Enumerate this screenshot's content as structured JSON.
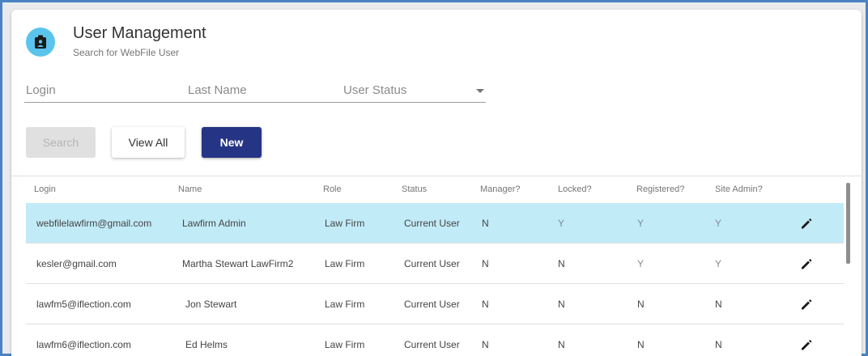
{
  "header": {
    "title": "User Management",
    "subtitle": "Search for WebFile User",
    "avatar_icon": "user-badge-icon",
    "avatar_color": "#5bc4ec"
  },
  "filters": {
    "login_label": "Login",
    "last_name_label": "Last Name",
    "user_status_label": "User Status"
  },
  "actions": {
    "search_label": "Search",
    "view_all_label": "View All",
    "new_label": "New",
    "new_color": "#263485"
  },
  "table": {
    "columns": [
      "Login",
      "Name",
      "Role",
      "Status",
      "Manager?",
      "Locked?",
      "Registered?",
      "Site Admin?"
    ],
    "rows": [
      {
        "login": "webfilelawfirm@gmail.com",
        "name": "Lawfirm Admin",
        "role": "Law Firm",
        "status": "Current User",
        "manager": "N",
        "locked": "Y",
        "registered": "Y",
        "site_admin": "Y",
        "selected": true
      },
      {
        "login": "kesler@gmail.com",
        "name": "Martha Stewart LawFirm2",
        "role": "Law Firm",
        "status": "Current User",
        "manager": "N",
        "locked": "N",
        "registered": "Y",
        "site_admin": "Y"
      },
      {
        "login": "lawfm5@iflection.com",
        "name": "Jon Stewart",
        "role": "Law Firm",
        "status": "Current User",
        "manager": "N",
        "locked": "N",
        "registered": "N",
        "site_admin": "N"
      },
      {
        "login": "lawfm6@iflection.com",
        "name": "Ed Helms",
        "role": "Law Firm",
        "status": "Current User",
        "manager": "N",
        "locked": "N",
        "registered": "N",
        "site_admin": "N"
      }
    ],
    "selected_row_color": "#c2ebf8",
    "row_action_icon": "pencil-edit-icon"
  }
}
